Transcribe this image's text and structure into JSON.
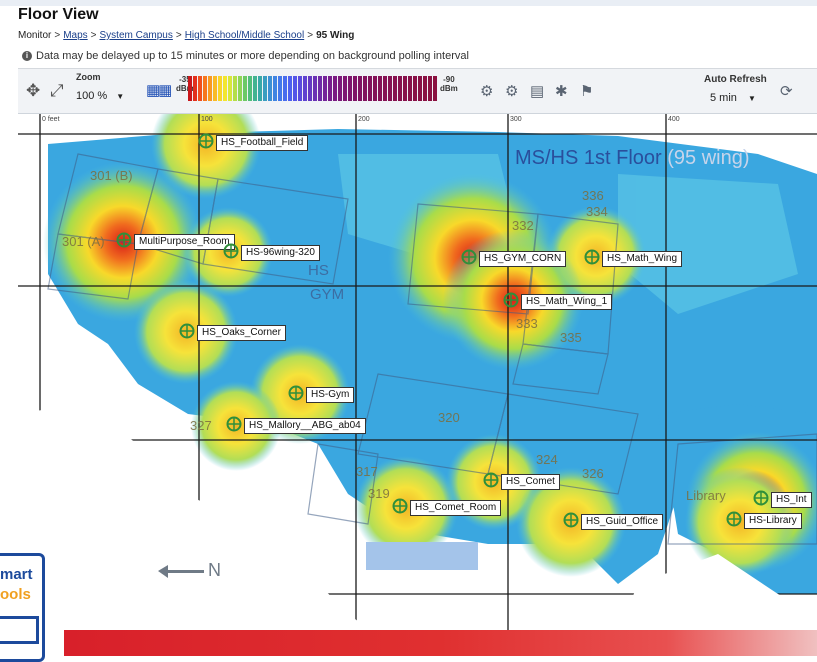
{
  "page": {
    "title": "Floor View",
    "breadcrumbs": [
      {
        "label": "Monitor",
        "link": false
      },
      {
        "label": "Maps",
        "link": true
      },
      {
        "label": "System Campus",
        "link": true
      },
      {
        "label": "High School/Middle School",
        "link": true
      },
      {
        "label": "95 Wing",
        "link": false,
        "current": true
      }
    ],
    "notice": "Data may be delayed up to 15 minutes or more depending on background polling interval"
  },
  "toolbar": {
    "zoom_label": "Zoom",
    "zoom_value": "100 %",
    "legend_min_value": "-35",
    "legend_min_unit": "dBm",
    "legend_max_value": "-90",
    "legend_max_unit": "dBm",
    "auto_refresh_label": "Auto Refresh",
    "auto_refresh_value": "5 min"
  },
  "map": {
    "ruler_ticks": [
      "0 feet",
      "100",
      "200",
      "300",
      "400"
    ],
    "floor_title": "MS/HS 1st Floor",
    "floor_title_suffix": "(95 wing)",
    "gym_label_1": "HS",
    "gym_label_2": "GYM",
    "room_numbers": [
      "301 (B)",
      "301 (A)",
      "332",
      "334",
      "336",
      "333",
      "335",
      "320",
      "317",
      "319",
      "324",
      "326",
      "327"
    ],
    "library_label": "Library",
    "north_label": "N",
    "access_points": [
      {
        "label": "HS_Football_Field"
      },
      {
        "label": "MultiPurpose_Room"
      },
      {
        "label": "HS-96wing-320"
      },
      {
        "label": "HS_Oaks_Corner"
      },
      {
        "label": "HS-Gym"
      },
      {
        "label": "HS_Mallory__ABG_ab04"
      },
      {
        "label": "HS_GYM_CORN"
      },
      {
        "label": "HS_Math_Wing"
      },
      {
        "label": "HS_Math_Wing_1"
      },
      {
        "label": "HS_Comet"
      },
      {
        "label": "HS_Comet_Room"
      },
      {
        "label": "HS_Guid_Office"
      },
      {
        "label": "HS_Int"
      },
      {
        "label": "HS-Library"
      }
    ]
  },
  "logo": {
    "line1": "mart",
    "line2": "ools"
  },
  "colors": {
    "heat_strong": "#e8231a",
    "heat_mid": "#f7e62a",
    "heat_weak": "#2a9ee8",
    "ap_marker": "#2f8f3a",
    "brand_blue": "#1c4a9c"
  }
}
